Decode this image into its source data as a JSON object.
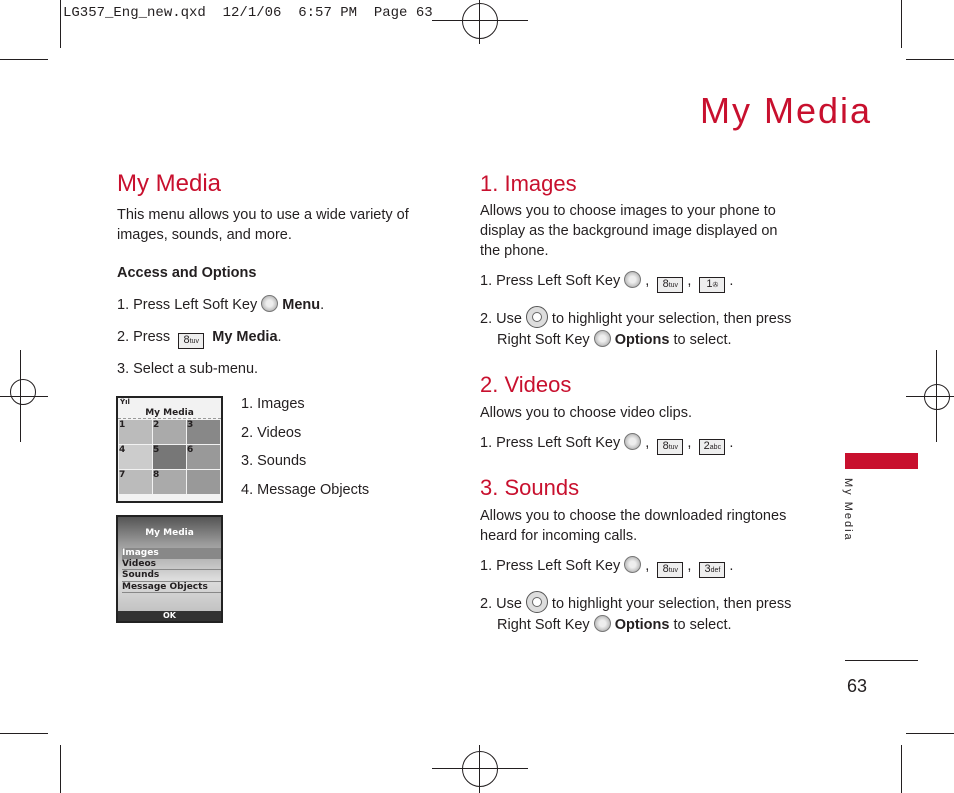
{
  "slug": "LG357_Eng_new.qxd  12/1/06  6:57 PM  Page 63",
  "page_title": "My Media",
  "side_tab": "My Media",
  "page_number": "63",
  "accent": "#c8102e",
  "left": {
    "heading": "My Media",
    "intro": "This menu allows you to use a wide variety of images, sounds, and more.",
    "access_heading": "Access and Options",
    "step1": "1. Press Left Soft Key",
    "step1_bold": "Menu",
    "step2": "2. Press",
    "step2_bold": "My Media",
    "step3": "3. Select a sub-menu.",
    "submenu": [
      "1. Images",
      "2. Videos",
      "3. Sounds",
      "4. Message Objects"
    ],
    "screen1": {
      "title": "My Media",
      "numbers": [
        "1",
        "2",
        "3",
        "4",
        "5",
        "6",
        "7",
        "8"
      ]
    },
    "screen2": {
      "title": "My Media",
      "items": [
        "Images",
        "Videos",
        "Sounds",
        "Message Objects"
      ],
      "softkey": "OK"
    }
  },
  "keys": {
    "k8": "8",
    "k8l": "tuv",
    "k1": "1",
    "k2": "2",
    "k2l": "abc",
    "k3": "3",
    "k3l": "def"
  },
  "right": {
    "images_heading": "1. Images",
    "images_desc": "Allows you to choose images to your phone to display as the background image displayed on the phone.",
    "images_step1": "1. Press Left Soft Key",
    "images_step2a": "2. Use",
    "images_step2b": "to highlight your selection, then press",
    "images_step2c": "Right Soft Key",
    "images_step2bold": "Options",
    "images_step2d": "to select.",
    "videos_heading": "2. Videos",
    "videos_desc": "Allows you to choose video clips.",
    "videos_step1": "1. Press Left Soft Key",
    "sounds_heading": "3. Sounds",
    "sounds_desc": "Allows you to choose the downloaded ringtones heard for incoming calls.",
    "sounds_step1": "1. Press Left Soft Key",
    "sounds_step2a": "2. Use",
    "sounds_step2b": "to highlight your selection, then press",
    "sounds_step2c": "Right Soft Key",
    "sounds_step2bold": "Options",
    "sounds_step2d": "to select."
  }
}
